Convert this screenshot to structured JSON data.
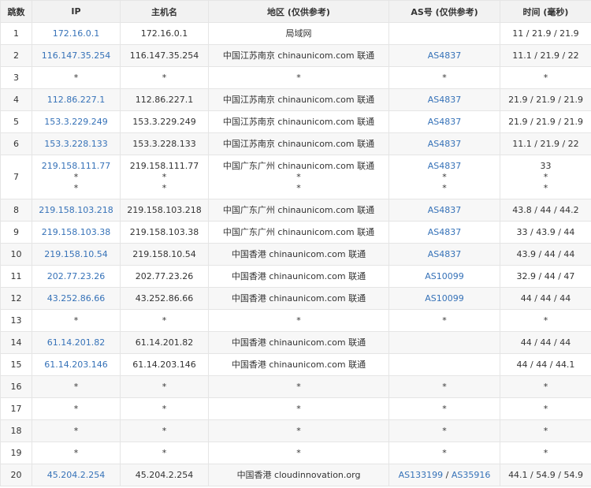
{
  "headers": [
    "跳数",
    "IP",
    "主机名",
    "地区 (仅供参考)",
    "AS号 (仅供参考)",
    "时间 (毫秒)"
  ],
  "rows": [
    {
      "hop": "1",
      "ip": [
        "172.16.0.1"
      ],
      "host": [
        "172.16.0.1"
      ],
      "region": [
        "局域网"
      ],
      "as": [
        []
      ],
      "time": [
        "11 / 21.9 / 21.9"
      ]
    },
    {
      "hop": "2",
      "ip": [
        "116.147.35.254"
      ],
      "host": [
        "116.147.35.254"
      ],
      "region": [
        "中国江苏南京 chinaunicom.com 联通"
      ],
      "as": [
        [
          "AS4837"
        ]
      ],
      "time": [
        "11.1 / 21.9 / 22"
      ]
    },
    {
      "hop": "3",
      "ip": [
        "*"
      ],
      "host": [
        "*"
      ],
      "region": [
        "*"
      ],
      "as": [
        [
          "*"
        ]
      ],
      "time": [
        "*"
      ]
    },
    {
      "hop": "4",
      "ip": [
        "112.86.227.1"
      ],
      "host": [
        "112.86.227.1"
      ],
      "region": [
        "中国江苏南京 chinaunicom.com 联通"
      ],
      "as": [
        [
          "AS4837"
        ]
      ],
      "time": [
        "21.9 / 21.9 / 21.9"
      ]
    },
    {
      "hop": "5",
      "ip": [
        "153.3.229.249"
      ],
      "host": [
        "153.3.229.249"
      ],
      "region": [
        "中国江苏南京 chinaunicom.com 联通"
      ],
      "as": [
        [
          "AS4837"
        ]
      ],
      "time": [
        "21.9 / 21.9 / 21.9"
      ]
    },
    {
      "hop": "6",
      "ip": [
        "153.3.228.133"
      ],
      "host": [
        "153.3.228.133"
      ],
      "region": [
        "中国江苏南京 chinaunicom.com 联通"
      ],
      "as": [
        [
          "AS4837"
        ]
      ],
      "time": [
        "11.1 / 21.9 / 22"
      ]
    },
    {
      "hop": "7",
      "ip": [
        "219.158.111.77",
        "*",
        "*"
      ],
      "host": [
        "219.158.111.77",
        "*",
        "*"
      ],
      "region": [
        "中国广东广州 chinaunicom.com 联通",
        "*",
        "*"
      ],
      "as": [
        [
          "AS4837"
        ],
        [
          "*"
        ],
        [
          "*"
        ]
      ],
      "time": [
        "33",
        "*",
        "*"
      ]
    },
    {
      "hop": "8",
      "ip": [
        "219.158.103.218"
      ],
      "host": [
        "219.158.103.218"
      ],
      "region": [
        "中国广东广州 chinaunicom.com 联通"
      ],
      "as": [
        [
          "AS4837"
        ]
      ],
      "time": [
        "43.8 / 44 / 44.2"
      ]
    },
    {
      "hop": "9",
      "ip": [
        "219.158.103.38"
      ],
      "host": [
        "219.158.103.38"
      ],
      "region": [
        "中国广东广州 chinaunicom.com 联通"
      ],
      "as": [
        [
          "AS4837"
        ]
      ],
      "time": [
        "33 / 43.9 / 44"
      ]
    },
    {
      "hop": "10",
      "ip": [
        "219.158.10.54"
      ],
      "host": [
        "219.158.10.54"
      ],
      "region": [
        "中国香港 chinaunicom.com 联通"
      ],
      "as": [
        [
          "AS4837"
        ]
      ],
      "time": [
        "43.9 / 44 / 44"
      ]
    },
    {
      "hop": "11",
      "ip": [
        "202.77.23.26"
      ],
      "host": [
        "202.77.23.26"
      ],
      "region": [
        "中国香港 chinaunicom.com 联通"
      ],
      "as": [
        [
          "AS10099"
        ]
      ],
      "time": [
        "32.9 / 44 / 47"
      ]
    },
    {
      "hop": "12",
      "ip": [
        "43.252.86.66"
      ],
      "host": [
        "43.252.86.66"
      ],
      "region": [
        "中国香港 chinaunicom.com 联通"
      ],
      "as": [
        [
          "AS10099"
        ]
      ],
      "time": [
        "44 / 44 / 44"
      ]
    },
    {
      "hop": "13",
      "ip": [
        "*"
      ],
      "host": [
        "*"
      ],
      "region": [
        "*"
      ],
      "as": [
        [
          "*"
        ]
      ],
      "time": [
        "*"
      ]
    },
    {
      "hop": "14",
      "ip": [
        "61.14.201.82"
      ],
      "host": [
        "61.14.201.82"
      ],
      "region": [
        "中国香港 chinaunicom.com 联通"
      ],
      "as": [
        []
      ],
      "time": [
        "44 / 44 / 44"
      ]
    },
    {
      "hop": "15",
      "ip": [
        "61.14.203.146"
      ],
      "host": [
        "61.14.203.146"
      ],
      "region": [
        "中国香港 chinaunicom.com 联通"
      ],
      "as": [
        []
      ],
      "time": [
        "44 / 44 / 44.1"
      ]
    },
    {
      "hop": "16",
      "ip": [
        "*"
      ],
      "host": [
        "*"
      ],
      "region": [
        "*"
      ],
      "as": [
        [
          "*"
        ]
      ],
      "time": [
        "*"
      ]
    },
    {
      "hop": "17",
      "ip": [
        "*"
      ],
      "host": [
        "*"
      ],
      "region": [
        "*"
      ],
      "as": [
        [
          "*"
        ]
      ],
      "time": [
        "*"
      ]
    },
    {
      "hop": "18",
      "ip": [
        "*"
      ],
      "host": [
        "*"
      ],
      "region": [
        "*"
      ],
      "as": [
        [
          "*"
        ]
      ],
      "time": [
        "*"
      ]
    },
    {
      "hop": "19",
      "ip": [
        "*"
      ],
      "host": [
        "*"
      ],
      "region": [
        "*"
      ],
      "as": [
        [
          "*"
        ]
      ],
      "time": [
        "*"
      ]
    },
    {
      "hop": "20",
      "ip": [
        "45.204.2.254"
      ],
      "host": [
        "45.204.2.254"
      ],
      "region": [
        "中国香港 cloudinnovation.org"
      ],
      "as": [
        [
          "AS133199",
          "AS35916"
        ]
      ],
      "time": [
        "44.1 / 54.9 / 54.9"
      ]
    }
  ],
  "as_separator": " / ",
  "colors": {
    "link": "#3672b8",
    "header_bg": "#f2f2f2",
    "border": "#e5e5e5",
    "stripe": "#f7f7f7"
  }
}
